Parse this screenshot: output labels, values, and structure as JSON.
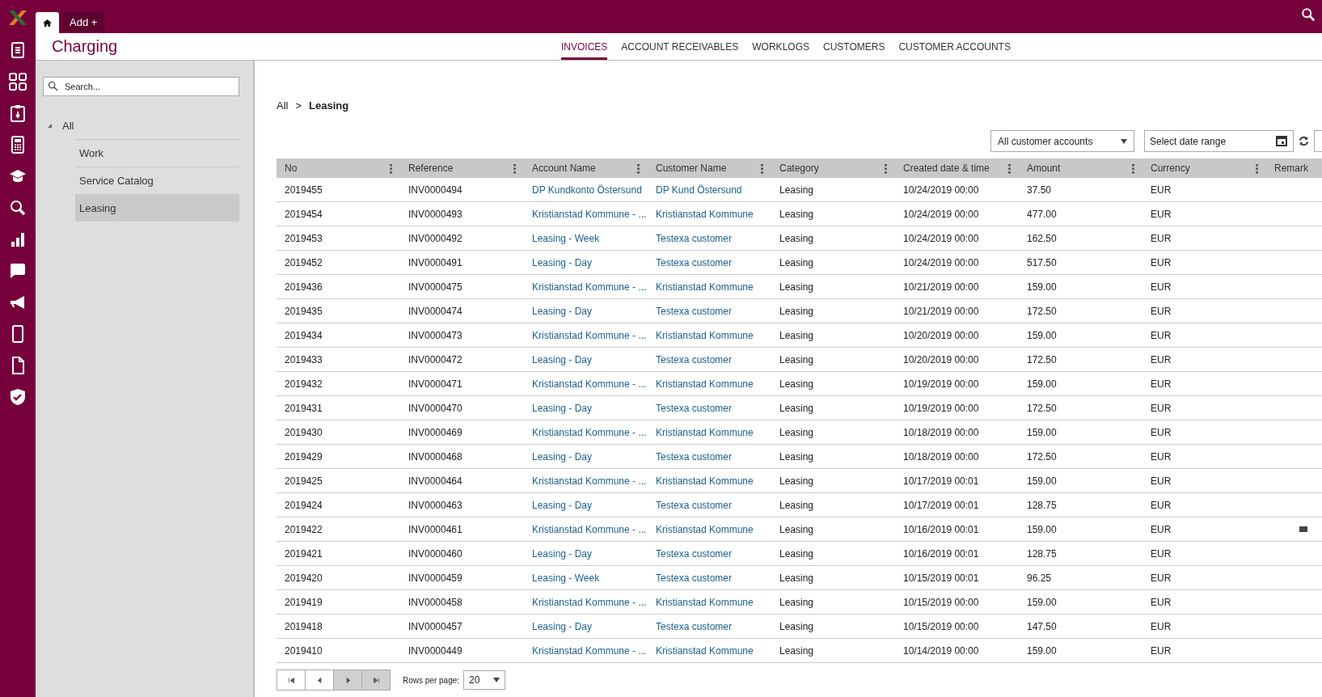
{
  "top_bar": {
    "tabs": [
      {
        "kind": "home",
        "selected": true
      },
      {
        "kind": "text",
        "label": "Add +",
        "selected": false
      }
    ]
  },
  "page_title": "Charging",
  "nav_tabs": [
    {
      "label": "INVOICES",
      "selected": true
    },
    {
      "label": "ACCOUNT RECEIVABLES",
      "selected": false
    },
    {
      "label": "WORKLOGS",
      "selected": false
    },
    {
      "label": "CUSTOMERS",
      "selected": false
    },
    {
      "label": "CUSTOMER ACCOUNTS",
      "selected": false
    }
  ],
  "sidebar": {
    "search": {
      "placeholder": "Search..."
    },
    "tree": [
      {
        "label": "All",
        "expanded": true,
        "selected": false,
        "children": [
          {
            "label": "Work",
            "selected": false
          },
          {
            "label": "Service Catalog",
            "selected": false
          },
          {
            "label": "Leasing",
            "selected": true
          }
        ]
      }
    ]
  },
  "breadcrumb": [
    {
      "label": "All",
      "current": false
    },
    {
      "label": "Leasing",
      "current": true
    }
  ],
  "breadcrumb_separator": ">",
  "filters": {
    "account_select": "All customer accounts",
    "date_range": {
      "placeholder": "Select date range"
    }
  },
  "table": {
    "columns": [
      "No",
      "Reference",
      "Account Name",
      "Customer Name",
      "Category",
      "Created date & time",
      "Amount",
      "Currency",
      "Remark"
    ],
    "rows": [
      {
        "no": "2019455",
        "reference": "INV0000494",
        "account": "DP Kundkonto Östersund",
        "customer": "DP Kund Östersund",
        "category": "Leasing",
        "created": "10/24/2019 00:00",
        "amount": "37.50",
        "currency": "EUR",
        "remark": false
      },
      {
        "no": "2019454",
        "reference": "INV0000493",
        "account": "Kristianstad Kommune - ...",
        "customer": "Kristianstad Kommune",
        "category": "Leasing",
        "created": "10/24/2019 00:00",
        "amount": "477.00",
        "currency": "EUR",
        "remark": false
      },
      {
        "no": "2019453",
        "reference": "INV0000492",
        "account": "Leasing - Week",
        "customer": "Testexa customer",
        "category": "Leasing",
        "created": "10/24/2019 00:00",
        "amount": "162.50",
        "currency": "EUR",
        "remark": false
      },
      {
        "no": "2019452",
        "reference": "INV0000491",
        "account": "Leasing - Day",
        "customer": "Testexa customer",
        "category": "Leasing",
        "created": "10/24/2019 00:00",
        "amount": "517.50",
        "currency": "EUR",
        "remark": false
      },
      {
        "no": "2019436",
        "reference": "INV0000475",
        "account": "Kristianstad Kommune - ...",
        "customer": "Kristianstad Kommune",
        "category": "Leasing",
        "created": "10/21/2019 00:00",
        "amount": "159.00",
        "currency": "EUR",
        "remark": false
      },
      {
        "no": "2019435",
        "reference": "INV0000474",
        "account": "Leasing - Day",
        "customer": "Testexa customer",
        "category": "Leasing",
        "created": "10/21/2019 00:00",
        "amount": "172.50",
        "currency": "EUR",
        "remark": false
      },
      {
        "no": "2019434",
        "reference": "INV0000473",
        "account": "Kristianstad Kommune - ...",
        "customer": "Kristianstad Kommune",
        "category": "Leasing",
        "created": "10/20/2019 00:00",
        "amount": "159.00",
        "currency": "EUR",
        "remark": false
      },
      {
        "no": "2019433",
        "reference": "INV0000472",
        "account": "Leasing - Day",
        "customer": "Testexa customer",
        "category": "Leasing",
        "created": "10/20/2019 00:00",
        "amount": "172.50",
        "currency": "EUR",
        "remark": false
      },
      {
        "no": "2019432",
        "reference": "INV0000471",
        "account": "Kristianstad Kommune - ...",
        "customer": "Kristianstad Kommune",
        "category": "Leasing",
        "created": "10/19/2019 00:00",
        "amount": "159.00",
        "currency": "EUR",
        "remark": false
      },
      {
        "no": "2019431",
        "reference": "INV0000470",
        "account": "Leasing - Day",
        "customer": "Testexa customer",
        "category": "Leasing",
        "created": "10/19/2019 00:00",
        "amount": "172.50",
        "currency": "EUR",
        "remark": false
      },
      {
        "no": "2019430",
        "reference": "INV0000469",
        "account": "Kristianstad Kommune - ...",
        "customer": "Kristianstad Kommune",
        "category": "Leasing",
        "created": "10/18/2019 00:00",
        "amount": "159.00",
        "currency": "EUR",
        "remark": false
      },
      {
        "no": "2019429",
        "reference": "INV0000468",
        "account": "Leasing - Day",
        "customer": "Testexa customer",
        "category": "Leasing",
        "created": "10/18/2019 00:00",
        "amount": "172.50",
        "currency": "EUR",
        "remark": false
      },
      {
        "no": "2019425",
        "reference": "INV0000464",
        "account": "Kristianstad Kommune - ...",
        "customer": "Kristianstad Kommune",
        "category": "Leasing",
        "created": "10/17/2019 00:01",
        "amount": "159.00",
        "currency": "EUR",
        "remark": false
      },
      {
        "no": "2019424",
        "reference": "INV0000463",
        "account": "Leasing - Day",
        "customer": "Testexa customer",
        "category": "Leasing",
        "created": "10/17/2019 00:01",
        "amount": "128.75",
        "currency": "EUR",
        "remark": false
      },
      {
        "no": "2019422",
        "reference": "INV0000461",
        "account": "Kristianstad Kommune - ...",
        "customer": "Kristianstad Kommune",
        "category": "Leasing",
        "created": "10/16/2019 00:01",
        "amount": "159.00",
        "currency": "EUR",
        "remark": true
      },
      {
        "no": "2019421",
        "reference": "INV0000460",
        "account": "Leasing - Day",
        "customer": "Testexa customer",
        "category": "Leasing",
        "created": "10/16/2019 00:01",
        "amount": "128.75",
        "currency": "EUR",
        "remark": false
      },
      {
        "no": "2019420",
        "reference": "INV0000459",
        "account": "Leasing - Week",
        "customer": "Testexa customer",
        "category": "Leasing",
        "created": "10/15/2019 00:01",
        "amount": "96.25",
        "currency": "EUR",
        "remark": false
      },
      {
        "no": "2019419",
        "reference": "INV0000458",
        "account": "Kristianstad Kommune - ...",
        "customer": "Kristianstad Kommune",
        "category": "Leasing",
        "created": "10/15/2019 00:00",
        "amount": "159.00",
        "currency": "EUR",
        "remark": false
      },
      {
        "no": "2019418",
        "reference": "INV0000457",
        "account": "Leasing - Day",
        "customer": "Testexa customer",
        "category": "Leasing",
        "created": "10/15/2019 00:00",
        "amount": "147.50",
        "currency": "EUR",
        "remark": false
      },
      {
        "no": "2019410",
        "reference": "INV0000449",
        "account": "Kristianstad Kommune - ...",
        "customer": "Kristianstad Kommune",
        "category": "Leasing",
        "created": "10/14/2019 00:00",
        "amount": "159.00",
        "currency": "EUR",
        "remark": false
      }
    ]
  },
  "pager": {
    "buttons": [
      {
        "kind": "first",
        "active": false
      },
      {
        "kind": "prev",
        "active": false
      },
      {
        "kind": "next",
        "active": true
      },
      {
        "kind": "last",
        "active": true
      }
    ],
    "rows_label": "Rows per page:",
    "rows_value": "20"
  }
}
